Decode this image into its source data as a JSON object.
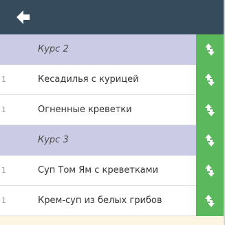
{
  "header": {
    "back_icon": "arrow-left-icon",
    "background": "#364b5c"
  },
  "rows": [
    {
      "type": "course",
      "quantity": "",
      "label": "Курс 2"
    },
    {
      "type": "dish",
      "quantity": "1",
      "label": "Кесадилья с курицей"
    },
    {
      "type": "dish",
      "quantity": "1",
      "label": "Огненные креветки"
    },
    {
      "type": "course",
      "quantity": "",
      "label": "Курс 3"
    },
    {
      "type": "dish",
      "quantity": "1",
      "label": "Суп Том Ям с креветками"
    },
    {
      "type": "dish",
      "quantity": "1",
      "label": "Крем-суп из белых грибов"
    }
  ],
  "move_icon": "reorder-arrows-icon",
  "colors": {
    "course_row": "#cccbe6",
    "move_button": "#5cb85c",
    "footer": "#fbf5e2"
  }
}
